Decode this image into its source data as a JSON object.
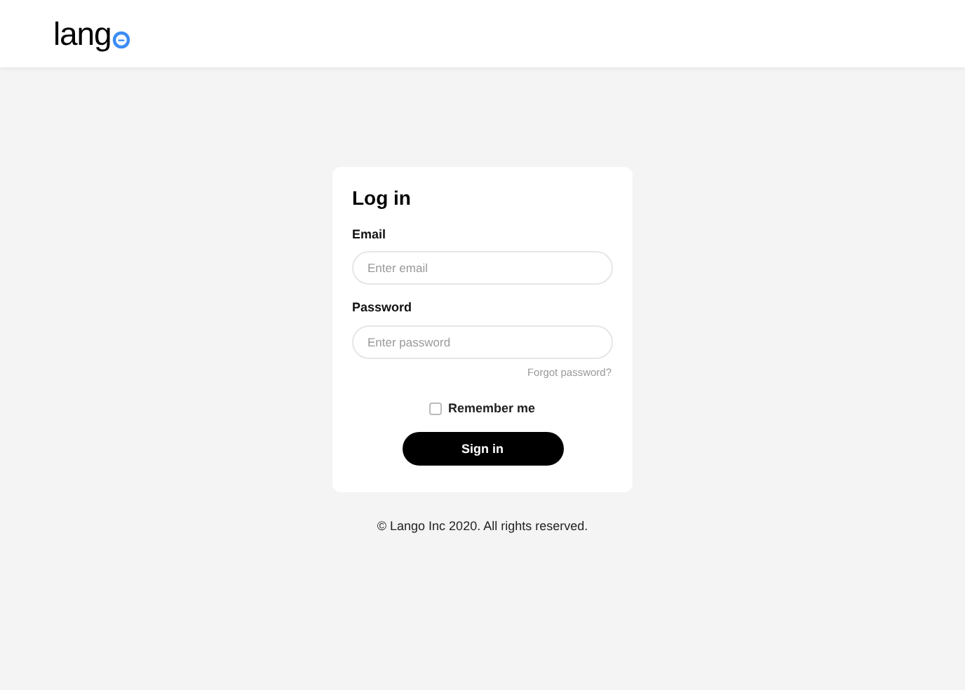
{
  "header": {
    "logo_text": "lang"
  },
  "login": {
    "title": "Log in",
    "fields": [
      {
        "label": "Email",
        "placeholder": "Enter email"
      },
      {
        "label": "Password",
        "placeholder": "Enter password"
      }
    ],
    "forgot_link": "Forgot password?",
    "remember": {
      "label": "Remember me",
      "checked": false
    },
    "submit": "Sign in"
  },
  "footer": "© Lango Inc 2020. All rights reserved."
}
